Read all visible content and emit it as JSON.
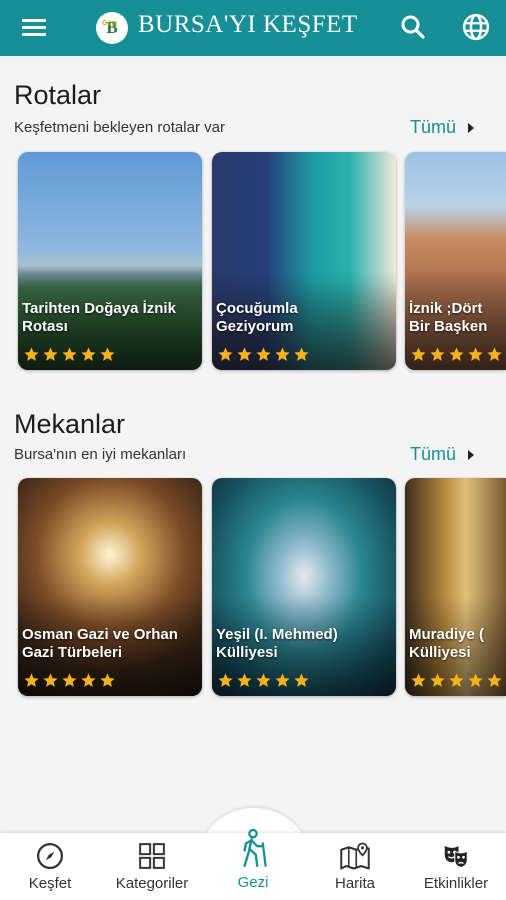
{
  "header": {
    "title": "BURSA'YI KEŞFET",
    "logo_letter": "B",
    "logo_small": "Gezi"
  },
  "routes": {
    "title": "Rotalar",
    "subtitle": "Keşfetmeni bekleyen rotalar var",
    "see_all": "Tümü",
    "cards": [
      {
        "title": "Tarihten Doğaya İznik\nRotası",
        "rating": 5
      },
      {
        "title": "Çocuğumla\nGeziyorum",
        "rating": 5
      },
      {
        "title": "İznik ;Dört\nBir Başken",
        "rating": 5
      }
    ]
  },
  "places": {
    "title": "Mekanlar",
    "subtitle": "Bursa'nın en iyi mekanları",
    "see_all": "Tümü",
    "cards": [
      {
        "title": "Osman Gazi ve Orhan\nGazi Türbeleri",
        "rating": 5
      },
      {
        "title": "Yeşil (I. Mehmed)\nKülliyesi",
        "rating": 5
      },
      {
        "title": "Muradiye (\nKülliyesi",
        "rating": 5
      }
    ]
  },
  "nav": [
    {
      "label": "Keşfet",
      "icon": "compass-icon"
    },
    {
      "label": "Kategoriler",
      "icon": "grid-icon"
    },
    {
      "label": "Gezi",
      "icon": "hiker-icon",
      "active": true
    },
    {
      "label": "Harita",
      "icon": "map-icon"
    },
    {
      "label": "Etkinlikler",
      "icon": "masks-icon"
    }
  ],
  "colors": {
    "primary": "#178f97",
    "star": "#f5b21a"
  }
}
